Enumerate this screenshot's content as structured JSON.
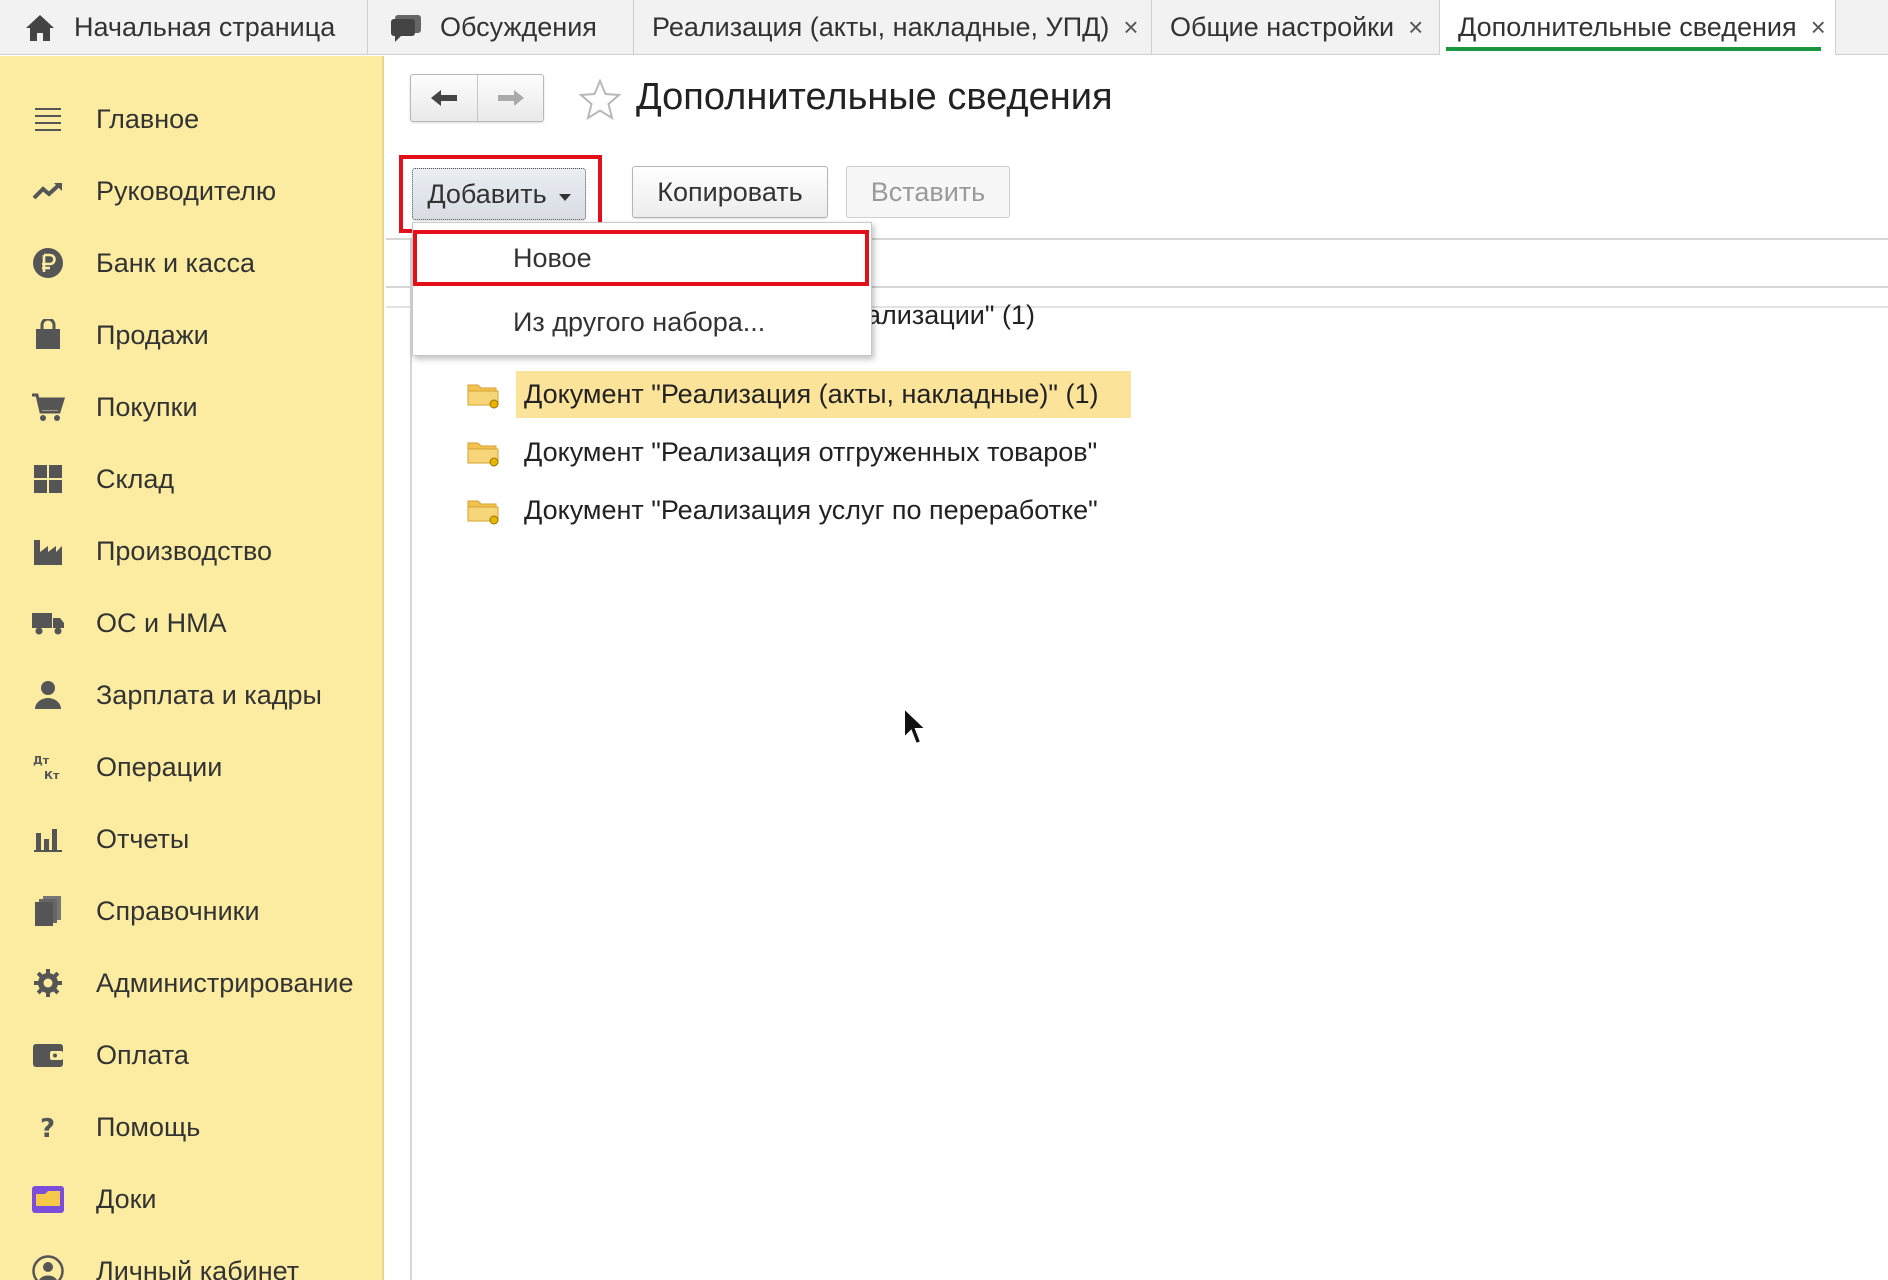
{
  "tabs": [
    {
      "label": "Начальная страница",
      "icon": "home-icon"
    },
    {
      "label": "Обсуждения",
      "icon": "chat-icon"
    },
    {
      "label": "Реализация (акты, накладные, УПД)",
      "closable": true
    },
    {
      "label": "Общие настройки",
      "closable": true
    },
    {
      "label": "Дополнительные сведения",
      "closable": true,
      "active": true
    }
  ],
  "close_glyph": "×",
  "sidebar": {
    "items": [
      {
        "label": "Главное",
        "icon": "menu-icon"
      },
      {
        "label": "Руководителю",
        "icon": "trend-icon"
      },
      {
        "label": "Банк и касса",
        "icon": "ruble-coin-icon"
      },
      {
        "label": "Продажи",
        "icon": "shopping-bag-icon"
      },
      {
        "label": "Покупки",
        "icon": "cart-icon"
      },
      {
        "label": "Склад",
        "icon": "warehouse-grid-icon"
      },
      {
        "label": "Производство",
        "icon": "factory-icon"
      },
      {
        "label": "ОС и НМА",
        "icon": "truck-icon"
      },
      {
        "label": "Зарплата и кадры",
        "icon": "person-icon"
      },
      {
        "label": "Операции",
        "icon": "dt-kt-icon"
      },
      {
        "label": "Отчеты",
        "icon": "bar-chart-icon"
      },
      {
        "label": "Справочники",
        "icon": "books-icon"
      },
      {
        "label": "Администрирование",
        "icon": "gear-icon"
      },
      {
        "label": "Оплата",
        "icon": "wallet-icon"
      },
      {
        "label": "Помощь",
        "icon": "question-icon"
      },
      {
        "label": "Доки",
        "icon": "docs-folder-icon"
      },
      {
        "label": "Личный кабинет",
        "icon": "user-circle-icon"
      }
    ]
  },
  "page": {
    "title": "Дополнительные сведения"
  },
  "toolbar": {
    "add_label": "Добавить",
    "copy_label": "Копировать",
    "paste_label": "Вставить"
  },
  "dropdown": {
    "items": [
      "Новое",
      "Из другого набора..."
    ]
  },
  "tree": {
    "partial_row": "ализации\" (1)",
    "rows": [
      {
        "label": "Документ \"Реализация (акты, накладные)\" (1)",
        "selected": true
      },
      {
        "label": "Документ \"Реализация отгруженных товаров\""
      },
      {
        "label": "Документ \"Реализация услуг по переработке\""
      }
    ]
  },
  "colors": {
    "sidebar_bg": "#fbeca1",
    "highlight_red": "#e3101a",
    "active_tab_underline": "#1a9641",
    "selected_row": "#fbe39a",
    "folder": "#f2c14e"
  }
}
